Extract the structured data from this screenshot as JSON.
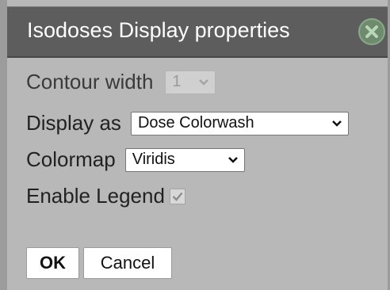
{
  "dialog": {
    "title": "Isodoses Display properties",
    "close_icon": "close-circle-icon"
  },
  "fields": {
    "contour_width": {
      "label": "Contour width",
      "value": "1",
      "disabled": true
    },
    "display_as": {
      "label": "Display as",
      "value": "Dose Colorwash"
    },
    "colormap": {
      "label": "Colormap",
      "value": "Viridis"
    },
    "enable_legend": {
      "label": "Enable Legend",
      "checked": true,
      "disabled": true
    }
  },
  "buttons": {
    "ok_label": "OK",
    "cancel_label": "Cancel"
  },
  "colors": {
    "titlebar": "#5d5d5d",
    "panel": "#b8b8b8",
    "close_button": "#6e8b6e"
  }
}
